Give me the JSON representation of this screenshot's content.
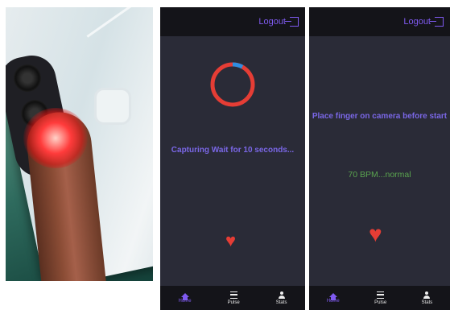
{
  "screen1": {
    "logout_label": "Logout",
    "status": "Capturing Wait for 10 seconds...",
    "progress_fraction": 0.08,
    "nav": [
      "Home",
      "Pulse",
      "Stats"
    ]
  },
  "screen2": {
    "logout_label": "Logout",
    "instruction": "Place finger on camera before start",
    "bpm_reading": "70 BPM...normal",
    "nav": [
      "Home",
      "Pulse",
      "Stats"
    ]
  },
  "colors": {
    "background": "#2a2b37",
    "header": "#141419",
    "accent": "#7f5af0",
    "ring_track": "#e53d35",
    "ring_progress": "#2f8ee0",
    "bpm_text": "#5aa44f",
    "heart": "#e53d35"
  },
  "icons": [
    "logout-icon",
    "home-icon",
    "menu-icon",
    "user-icon",
    "heart-icon"
  ]
}
